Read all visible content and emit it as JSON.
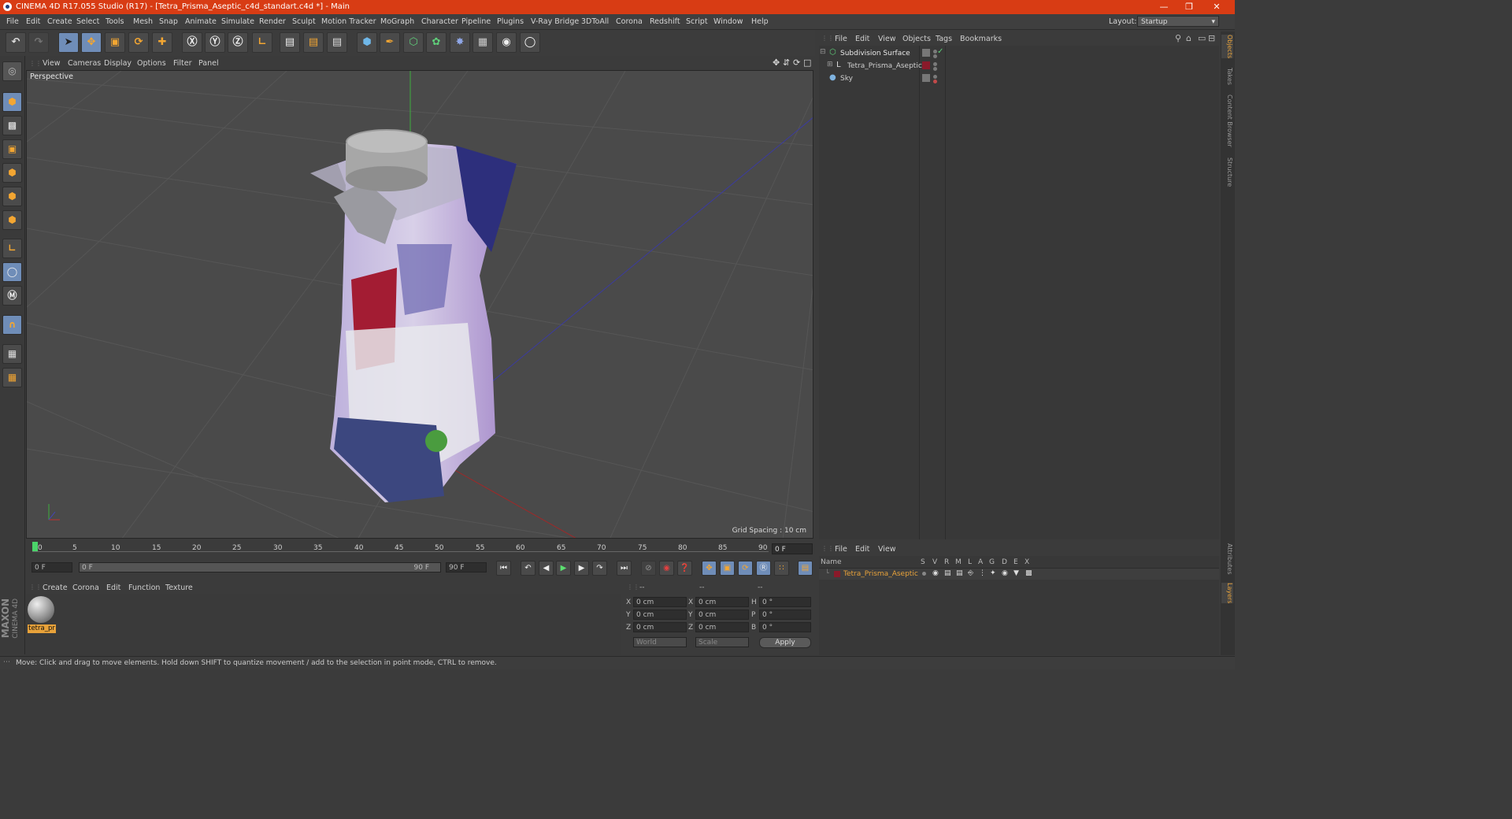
{
  "window": {
    "title": "CINEMA 4D R17.055 Studio (R17) - [Tetra_Prisma_Aseptic_c4d_standart.c4d *] - Main"
  },
  "menubar": {
    "items": [
      "File",
      "Edit",
      "Create",
      "Select",
      "Tools",
      "Mesh",
      "Snap",
      "Animate",
      "Simulate",
      "Render",
      "Sculpt",
      "Motion Tracker",
      "MoGraph",
      "Character",
      "Pipeline",
      "Plugins",
      "V-Ray Bridge",
      "3DToAll",
      "Corona",
      "Redshift",
      "Script",
      "Window",
      "Help"
    ],
    "layout_label": "Layout:",
    "layout_value": "Startup"
  },
  "viewport": {
    "menu": [
      "View",
      "Cameras",
      "Display",
      "Options",
      "Filter",
      "Panel"
    ],
    "name": "Perspective",
    "grid_spacing": "Grid Spacing : 10 cm"
  },
  "timeline": {
    "ticks": [
      "0",
      "5",
      "10",
      "15",
      "20",
      "25",
      "30",
      "35",
      "40",
      "45",
      "50",
      "55",
      "60",
      "65",
      "70",
      "75",
      "80",
      "85",
      "90"
    ],
    "current_frame": "0 F",
    "start_field": "0 F",
    "range_start": "0 F",
    "range_end": "90 F",
    "end_field": "90 F"
  },
  "material_manager": {
    "menu": [
      "Create",
      "Corona",
      "Edit",
      "Function",
      "Texture"
    ],
    "materials": [
      {
        "name": "tetra_pr"
      }
    ]
  },
  "coordinates": {
    "headers": [
      "--",
      "--",
      "--"
    ],
    "rows": [
      {
        "axis": "X",
        "pos": "0 cm",
        "saxis": "X",
        "size": "0 cm",
        "raxis": "H",
        "rot": "0 °"
      },
      {
        "axis": "Y",
        "pos": "0 cm",
        "saxis": "Y",
        "size": "0 cm",
        "raxis": "P",
        "rot": "0 °"
      },
      {
        "axis": "Z",
        "pos": "0 cm",
        "saxis": "Z",
        "size": "0 cm",
        "raxis": "B",
        "rot": "0 °"
      }
    ],
    "mode1": "World",
    "mode2": "Scale",
    "apply": "Apply"
  },
  "object_manager": {
    "menu": [
      "File",
      "Edit",
      "View",
      "Objects",
      "Tags",
      "Bookmarks"
    ],
    "objects": [
      {
        "name": "Subdivision Surface"
      },
      {
        "name": "Tetra_Prisma_Aseptic"
      },
      {
        "name": "Sky"
      }
    ]
  },
  "layer_manager": {
    "menu": [
      "File",
      "Edit",
      "View"
    ],
    "columns": [
      "Name",
      "S",
      "V",
      "R",
      "M",
      "L",
      "A",
      "G",
      "D",
      "E",
      "X"
    ],
    "layers": [
      {
        "name": "Tetra_Prisma_Aseptic"
      }
    ]
  },
  "right_tabs": [
    "Objects",
    "Takes",
    "Content Browser",
    "Structure",
    "Attributes",
    "Layers"
  ],
  "status": "Move: Click and drag to move elements. Hold down SHIFT to quantize movement / add to the selection in point mode, CTRL to remove.",
  "branding": [
    "MAXON",
    "CINEMA 4D"
  ],
  "colors": {
    "titlebar": "#d83c14",
    "accent_blue": "#6f8db8",
    "icon_orange": "#f3a632",
    "layer_red": "#8a1a2a",
    "layer_name": "#e8a23a"
  }
}
